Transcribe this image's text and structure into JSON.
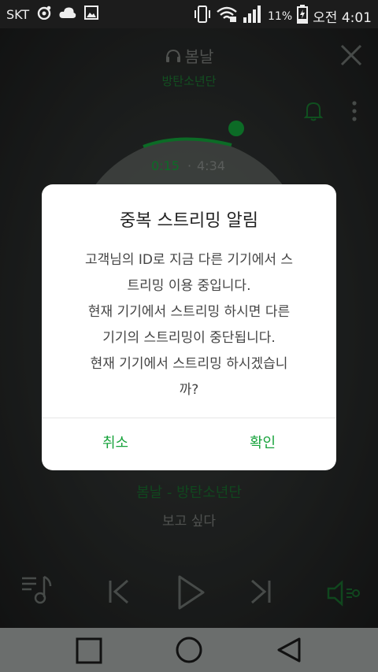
{
  "status_bar": {
    "carrier": "SKT",
    "battery": "11%",
    "time": "오전 4:01",
    "icons": [
      "record-icon",
      "cloud-icon",
      "image-icon",
      "vibrate-icon",
      "wifi-lock-icon",
      "signal-icon",
      "battery-charging-icon"
    ]
  },
  "player": {
    "title": "봄날",
    "artist": "방탄소년단",
    "time_current": "0:15",
    "time_separator": "·",
    "time_total": "4:34",
    "now_playing": "봄날 - 방탄소년단",
    "lyric": "보고 싶다",
    "accent_color": "#13a53b"
  },
  "dialog": {
    "title": "중복 스트리밍 알림",
    "body_lines": [
      "고객님의 ID로 지금 다른 기기에서 스",
      "트리밍 이용 중입니다.",
      "현재 기기에서 스트리밍 하시면 다른",
      "기기의 스트리밍이 중단됩니다.",
      "현재 기기에서 스트리밍 하시겠습니",
      "까?"
    ],
    "cancel_label": "취소",
    "confirm_label": "확인",
    "button_color": "#18a33c"
  },
  "nav_bar": {
    "icons": [
      "recent-apps-icon",
      "home-icon",
      "back-icon"
    ]
  }
}
